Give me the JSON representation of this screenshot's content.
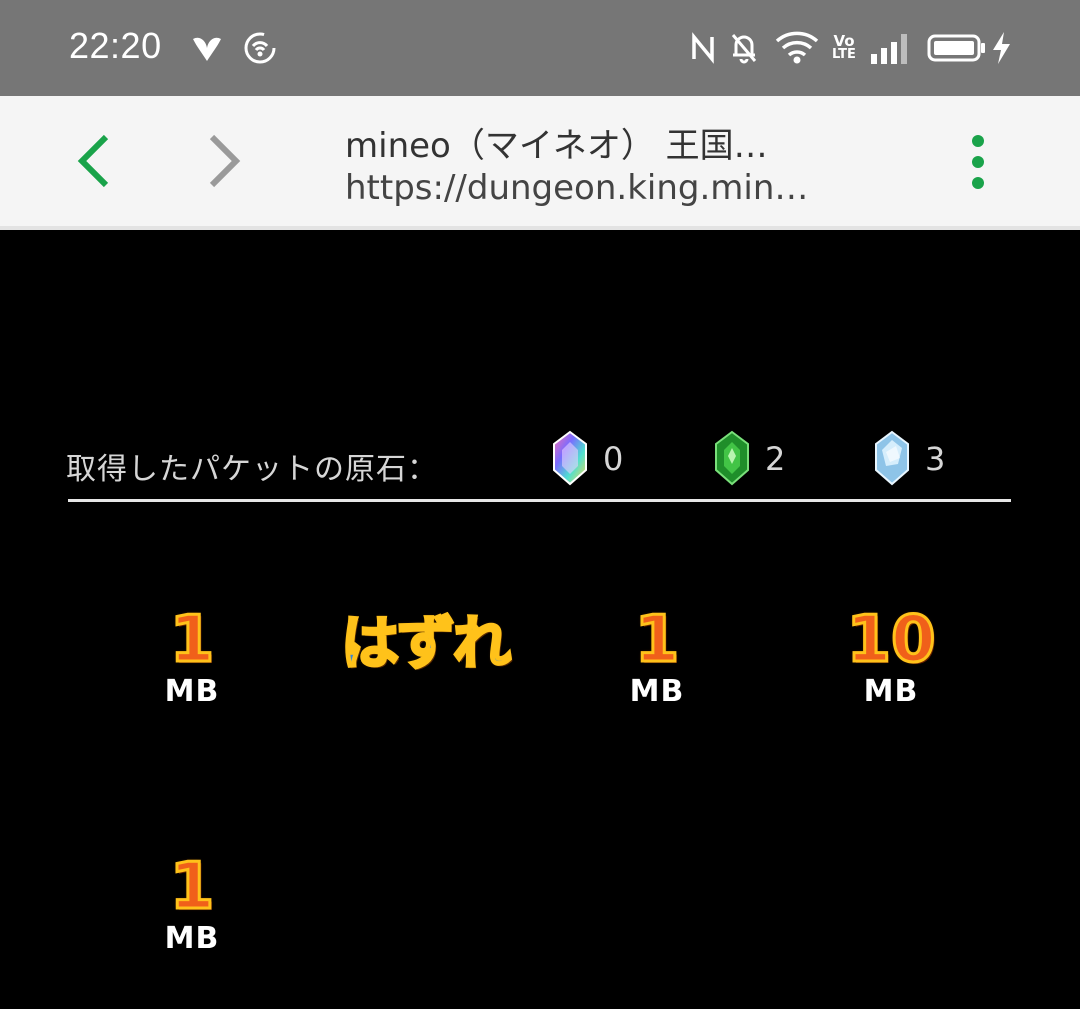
{
  "status_bar": {
    "time": "22:20",
    "left_icons": [
      "leaf-notification-icon",
      "sync-notification-icon"
    ],
    "right_icons": [
      "nfc-icon",
      "bell-off-icon",
      "wifi-icon",
      "volte-icon",
      "signal-icon",
      "battery-icon",
      "charging-icon"
    ],
    "volte_top": "Vo",
    "volte_bottom": "LTE"
  },
  "browser": {
    "title": "mineo（マイネオ） 王国…",
    "url": "https://dungeon.king.min…",
    "accent_color": "#1aa34a"
  },
  "game": {
    "stones_label": "取得したパケットの原石：",
    "stones": [
      {
        "name": "rainbow-gem-icon",
        "count": "0",
        "color": "#9a6ad8"
      },
      {
        "name": "green-gem-icon",
        "count": "2",
        "color": "#2fb03a"
      },
      {
        "name": "ice-gem-icon",
        "count": "3",
        "color": "#a8d4f0"
      }
    ],
    "prizes": [
      {
        "value": "1",
        "unit": "MB"
      },
      {
        "value": "はずれ",
        "unit": ""
      },
      {
        "value": "1",
        "unit": "MB"
      },
      {
        "value": "10",
        "unit": "MB"
      },
      {
        "value": "1",
        "unit": "MB"
      }
    ]
  }
}
